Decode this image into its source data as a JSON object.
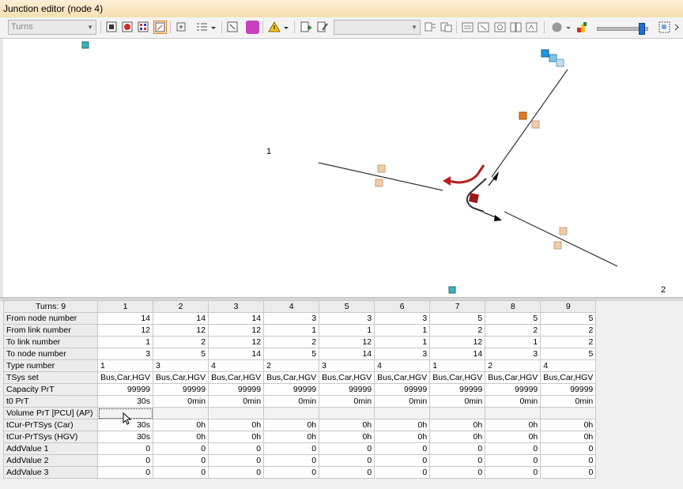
{
  "window": {
    "title": "Junction editor (node 4)"
  },
  "toolbar": {
    "view_combo": "Turns",
    "colors": {
      "active_border": "#e07c1f",
      "magenta": "#c83fbf",
      "red": "#d42a2a"
    }
  },
  "canvas": {
    "labels": {
      "left_number": "1",
      "right_number": "2"
    }
  },
  "table": {
    "corner": "Turns: 9",
    "columns": [
      "1",
      "2",
      "3",
      "4",
      "5",
      "6",
      "7",
      "8",
      "9"
    ],
    "rows": [
      {
        "label": "From node number",
        "values": [
          "14",
          "14",
          "14",
          "3",
          "3",
          "3",
          "5",
          "5",
          "5"
        ]
      },
      {
        "label": "From link number",
        "values": [
          "12",
          "12",
          "12",
          "1",
          "1",
          "1",
          "2",
          "2",
          "2"
        ]
      },
      {
        "label": "To link number",
        "values": [
          "1",
          "2",
          "12",
          "2",
          "12",
          "1",
          "12",
          "1",
          "2"
        ]
      },
      {
        "label": "To node number",
        "values": [
          "3",
          "5",
          "14",
          "5",
          "14",
          "3",
          "14",
          "3",
          "5"
        ]
      },
      {
        "label": "Type number",
        "values": [
          "1",
          "3",
          "4",
          "2",
          "3",
          "4",
          "1",
          "2",
          "4"
        ]
      },
      {
        "label": "TSys set",
        "values": [
          "Bus,Car,HGV",
          "Bus,Car,HGV",
          "Bus,Car,HGV",
          "Bus,Car,HGV",
          "Bus,Car,HGV",
          "Bus,Car,HGV",
          "Bus,Car,HGV",
          "Bus,Car,HGV",
          "Bus,Car,HGV"
        ]
      },
      {
        "label": "Capacity PrT",
        "values": [
          "99999",
          "99999",
          "99999",
          "99999",
          "99999",
          "99999",
          "99999",
          "99999",
          "99999"
        ]
      },
      {
        "label": "t0 PrT",
        "values": [
          "30s",
          "0min",
          "0min",
          "0min",
          "0min",
          "0min",
          "0min",
          "0min",
          "0min"
        ]
      },
      {
        "label": "Volume PrT [PCU] (AP)",
        "values": [
          "",
          "",
          "",
          "",
          "",
          "",
          "",
          "",
          ""
        ]
      },
      {
        "label": "tCur-PrTSys (Car)",
        "values": [
          "30s",
          "0h",
          "0h",
          "0h",
          "0h",
          "0h",
          "0h",
          "0h",
          "0h"
        ]
      },
      {
        "label": "tCur-PrTSys (HGV)",
        "values": [
          "30s",
          "0h",
          "0h",
          "0h",
          "0h",
          "0h",
          "0h",
          "0h",
          "0h"
        ]
      },
      {
        "label": "AddValue 1",
        "values": [
          "0",
          "0",
          "0",
          "0",
          "0",
          "0",
          "0",
          "0",
          "0"
        ]
      },
      {
        "label": "AddValue 2",
        "values": [
          "0",
          "0",
          "0",
          "0",
          "0",
          "0",
          "0",
          "0",
          "0"
        ]
      },
      {
        "label": "AddValue 3",
        "values": [
          "0",
          "0",
          "0",
          "0",
          "0",
          "0",
          "0",
          "0",
          "0"
        ]
      }
    ]
  }
}
